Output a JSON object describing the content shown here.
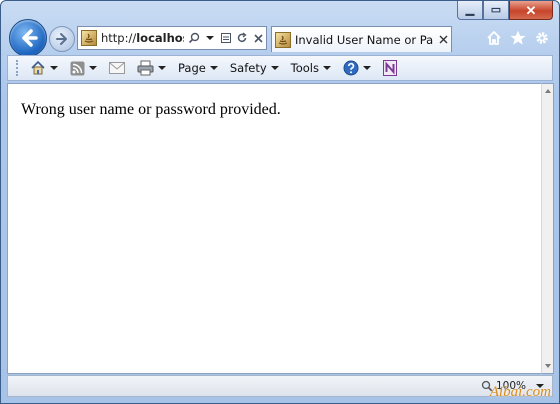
{
  "window": {
    "caption_buttons": {
      "minimize_icon": "minimize-icon",
      "maximize_icon": "maximize-icon",
      "close_icon": "close-icon"
    }
  },
  "nav": {
    "back_icon": "back-arrow-icon",
    "forward_icon": "forward-arrow-icon",
    "address": {
      "url_prefix": "http://",
      "url_host": "localhost:",
      "icons": [
        "search-icon",
        "dropdown-caret-icon",
        "compatibility-view-icon",
        "refresh-icon",
        "stop-icon"
      ]
    },
    "tab": {
      "title": "Invalid User Name or Pass..."
    },
    "right_icons": [
      "home-icon",
      "favorites-star-icon",
      "tools-gear-icon"
    ]
  },
  "commandbar": {
    "items": [
      {
        "icon": "home-icon",
        "label": ""
      },
      {
        "icon": "rss-feed-icon",
        "label": ""
      },
      {
        "icon": "mail-icon",
        "label": ""
      },
      {
        "icon": "print-icon",
        "label": ""
      },
      {
        "icon": "",
        "label": "Page"
      },
      {
        "icon": "",
        "label": "Safety"
      },
      {
        "icon": "",
        "label": "Tools"
      },
      {
        "icon": "help-icon",
        "label": ""
      },
      {
        "icon": "onenote-icon",
        "label": ""
      }
    ]
  },
  "content": {
    "message": "Wrong user name or password provided."
  },
  "statusbar": {
    "zoom": "100%"
  },
  "watermark": "Aibai.com",
  "colors": {
    "frame": "#aac6ea",
    "accent": "#1f67c2",
    "close_button": "#c7452b",
    "watermark": "#d88b1c"
  }
}
